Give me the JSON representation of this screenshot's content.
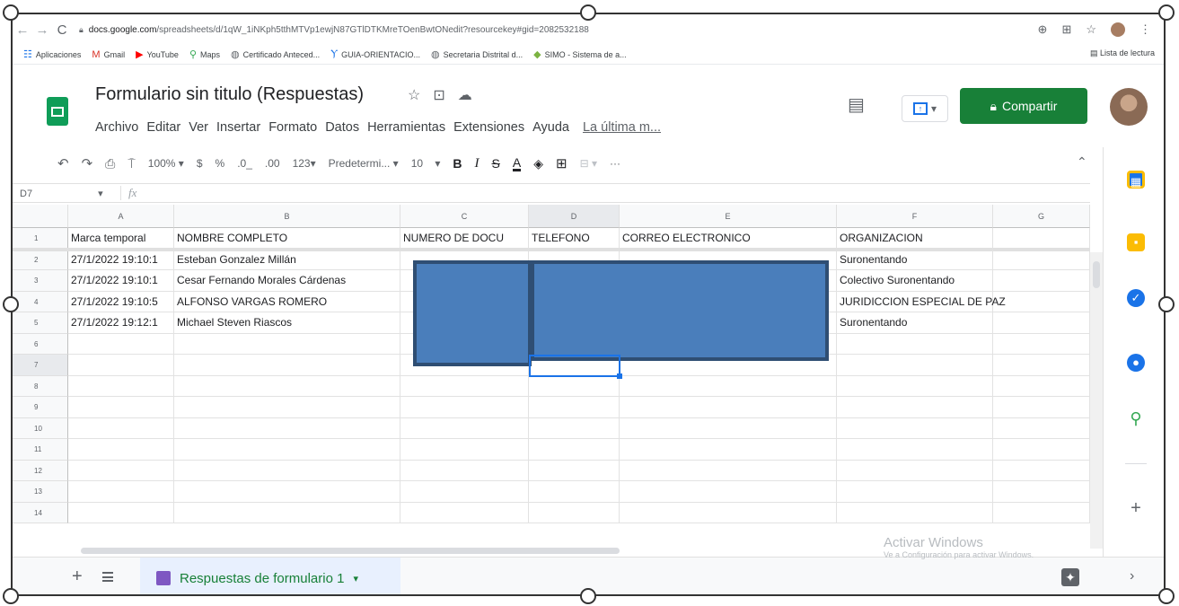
{
  "browser": {
    "url_host": "docs.google.com",
    "url_path": "/spreadsheets/d/1qW_1iNKph5tthMTVp1ewjN87GTlDTKMreTOenBwtONedit?resourcekey#gid=2082532188",
    "bookmarks": [
      {
        "label": "Aplicaciones",
        "icon": "apps-grid-icon",
        "color": "#1a73e8",
        "glyph": "☷"
      },
      {
        "label": "Gmail",
        "icon": "gmail-icon",
        "color": "#d93025",
        "glyph": "M"
      },
      {
        "label": "YouTube",
        "icon": "youtube-icon",
        "color": "#ff0000",
        "glyph": "▶"
      },
      {
        "label": "Maps",
        "icon": "maps-pin-icon",
        "color": "#34a853",
        "glyph": "⚲"
      },
      {
        "label": "Certificado Anteced...",
        "icon": "globe-icon",
        "color": "#5f6368",
        "glyph": "◍"
      },
      {
        "label": "GUIA-ORIENTACIO...",
        "icon": "bookmark-icon",
        "color": "#1a73e8",
        "glyph": "Ⲩ"
      },
      {
        "label": "Secretaria Distrital d...",
        "icon": "globe-icon",
        "color": "#5f6368",
        "glyph": "◍"
      },
      {
        "label": "SIMO - Sistema de a...",
        "icon": "leaf-icon",
        "color": "#7cb342",
        "glyph": "◆"
      }
    ],
    "reading_list": "Lista de lectura"
  },
  "doc": {
    "title": "Formulario sin titulo (Respuestas)",
    "menu": [
      "Archivo",
      "Editar",
      "Ver",
      "Insertar",
      "Formato",
      "Datos",
      "Herramientas",
      "Extensiones",
      "Ayuda"
    ],
    "last_edit": "La última m...",
    "share_label": "Compartir",
    "accent": "#188038"
  },
  "toolbar": {
    "zoom": "100%",
    "currency": "$",
    "percent": "%",
    "dec_less": ".0_",
    "dec_more": ".00",
    "format_more": "123",
    "font": "Predetermi...",
    "font_size": "10",
    "bold": "B",
    "italic": "I",
    "strike": "S",
    "text_color": "A",
    "more": "···"
  },
  "formula_bar": {
    "cell_ref": "D7",
    "fx": "fx"
  },
  "columns": [
    "A",
    "B",
    "C",
    "D",
    "E",
    "F",
    "G"
  ],
  "headers": [
    "Marca temporal",
    "NOMBRE COMPLETO",
    "NUMERO DE DOCU",
    "TELEFONO",
    "CORREO ELECTRONICO",
    "ORGANIZACION",
    ""
  ],
  "rows": [
    [
      "27/1/2022 19:10:1",
      "Esteban Gonzalez Millán",
      "",
      "",
      "",
      "Suronentando",
      ""
    ],
    [
      "27/1/2022 19:10:1",
      "Cesar Fernando Morales Cárdenas",
      "",
      "",
      "",
      "Colectivo Suronentando",
      ""
    ],
    [
      "27/1/2022 19:10:5",
      "ALFONSO  VARGAS  ROMERO",
      "",
      "",
      "",
      "JURIDICCION  ESPECIAL  DE PAZ",
      ""
    ],
    [
      "27/1/2022 19:12:1",
      "Michael Steven Riascos",
      "",
      "",
      "",
      "Suronentando",
      ""
    ]
  ],
  "row_numbers": [
    "1",
    "2",
    "3",
    "4",
    "5",
    "6",
    "7",
    "8",
    "9",
    "10",
    "11",
    "12",
    "13",
    "14"
  ],
  "sheet_tab": "Respuestas de formulario 1",
  "watermark": {
    "line1": "Activar Windows",
    "line2": "Ve a Configuración para activar Windows."
  },
  "redaction_color": "#4a7ebb"
}
